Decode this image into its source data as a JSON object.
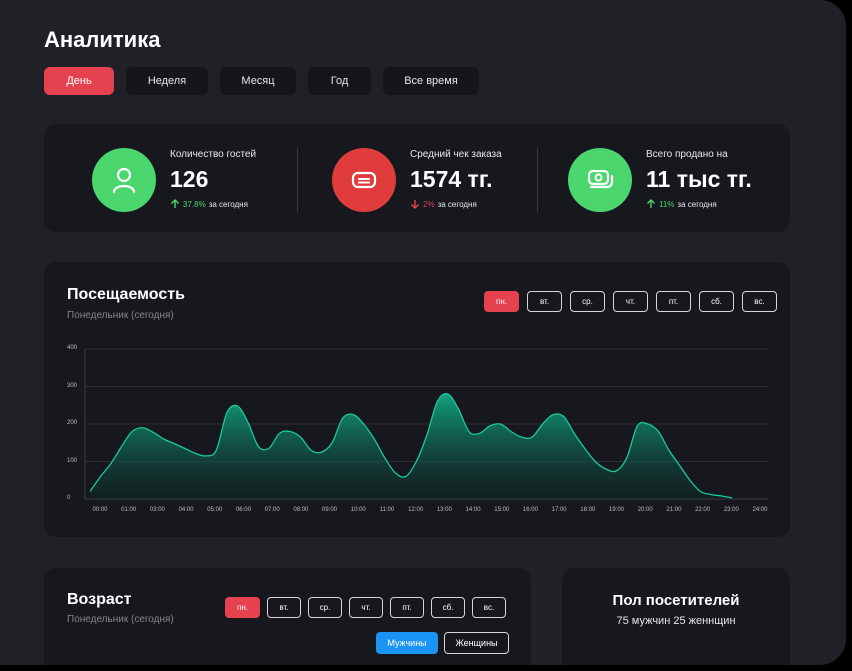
{
  "header": {
    "title": "Аналитика",
    "periods": [
      "День",
      "Неделя",
      "Месяц",
      "Год",
      "Все время"
    ],
    "active_period": "День"
  },
  "stats": [
    {
      "label": "Количество гостей",
      "value": "126",
      "trend_value": "37.8%",
      "trend_suffix": "за сегодня",
      "direction": "up",
      "icon": "user-icon",
      "color": "#4ad66d"
    },
    {
      "label": "Средний чек заказа",
      "value": "1574 тг.",
      "trend_value": "2%",
      "trend_suffix": "за сегодня",
      "direction": "down",
      "icon": "receipt-icon",
      "color": "#e03c3c"
    },
    {
      "label": "Всего продано на",
      "value": "11 тыс тг.",
      "trend_value": "11%",
      "trend_suffix": "за сегодня",
      "direction": "up",
      "icon": "money-stack-icon",
      "color": "#4ad66d"
    }
  ],
  "attendance": {
    "title": "Посещаемость",
    "subtitle": "Понедельник (сегодня)",
    "days": [
      "пн.",
      "вт.",
      "ср.",
      "чт.",
      "пт.",
      "сб.",
      "вс."
    ],
    "active_day": "пн."
  },
  "chart_data": {
    "type": "area",
    "title": "",
    "xlabel": "",
    "ylabel": "",
    "ylim": [
      0,
      400
    ],
    "yticks": [
      400,
      300,
      200,
      100,
      0
    ],
    "x_ticks": [
      "00:00",
      "01:00",
      "03:00",
      "04:00",
      "05:00",
      "06:00",
      "07:00",
      "08:00",
      "09:00",
      "10:00",
      "11:00",
      "12:00",
      "13:00",
      "14:00",
      "15:00",
      "16:00",
      "17:00",
      "18:00",
      "19:00",
      "20:00",
      "21:00",
      "22:00",
      "23:00",
      "24:00"
    ],
    "x": [
      0,
      0.2,
      0.5,
      1,
      1.5,
      2,
      2.5,
      3,
      3.4,
      3.8,
      4.1,
      4.5,
      5,
      5.5,
      6,
      6.4,
      6.8,
      7.2,
      7.6,
      8,
      8.5,
      9,
      9.5,
      10,
      10.5,
      11,
      11.4,
      11.8,
      12.2,
      12.5,
      13,
      13.5,
      14,
      14.5,
      15,
      15.5,
      16,
      16.4,
      16.8,
      17.2,
      17.6,
      18,
      18.4,
      18.7,
      19,
      19.4,
      19.8,
      20.2,
      20.6,
      21,
      21.4,
      21.8,
      22.2,
      23
    ],
    "values": [
      20,
      60,
      95,
      140,
      180,
      190,
      178,
      160,
      148,
      135,
      122,
      115,
      130,
      230,
      248,
      205,
      140,
      135,
      175,
      180,
      165,
      130,
      125,
      150,
      215,
      225,
      200,
      160,
      110,
      70,
      60,
      100,
      170,
      260,
      280,
      240,
      180,
      175,
      195,
      200,
      180,
      165,
      165,
      200,
      225,
      220,
      175,
      135,
      100,
      80,
      75,
      110,
      195,
      200,
      180,
      130,
      90,
      50,
      20,
      12,
      8,
      3
    ],
    "grid": true,
    "series_color": "#0fa37f"
  },
  "age": {
    "title": "Возраст",
    "subtitle": "Понедельник (сегодня)",
    "days": [
      "пн.",
      "вт.",
      "ср.",
      "чт.",
      "пт.",
      "сб.",
      "вс."
    ],
    "active_day": "пн.",
    "gender_male": "Мужчины",
    "gender_female": "Женщины"
  },
  "visitors_gender": {
    "title": "Пол посетителей",
    "summary": "75 мужчин 25 женнщин"
  }
}
